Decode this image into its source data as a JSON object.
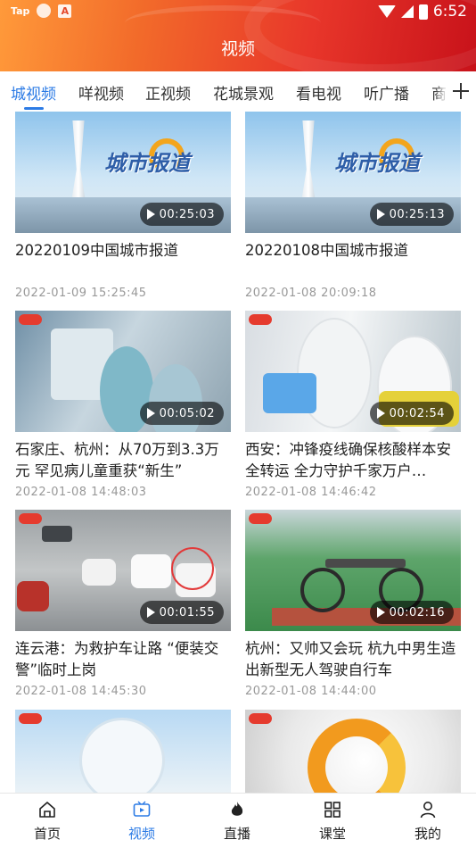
{
  "status_bar": {
    "left_label": "Tap",
    "left_letter": "A",
    "time": "6:52"
  },
  "header": {
    "title": "视频"
  },
  "tabs": [
    {
      "label": "城视频",
      "active": true
    },
    {
      "label": "咩视频",
      "active": false
    },
    {
      "label": "正视频",
      "active": false
    },
    {
      "label": "花城景观",
      "active": false
    },
    {
      "label": "看电视",
      "active": false
    },
    {
      "label": "听广播",
      "active": false
    },
    {
      "label": "商",
      "active": false
    }
  ],
  "thumbnail_captions": {
    "city_report": "城市报道",
    "city_report_prefix": "中国"
  },
  "videos": [
    {
      "title": "20220109中国城市报道",
      "duration": "00:25:03",
      "date": "2022-01-09  15:25:45"
    },
    {
      "title": "20220108中国城市报道",
      "duration": "00:25:13",
      "date": "2022-01-08  20:09:18"
    },
    {
      "title": "石家庄、杭州：从70万到3.3万元  罕见病儿童重获“新生”",
      "duration": "00:05:02",
      "date": "2022-01-08  14:48:03"
    },
    {
      "title": "西安：冲锋疫线确保核酸样本安全转运  全力守护千家万户…",
      "duration": "00:02:54",
      "date": "2022-01-08  14:46:42"
    },
    {
      "title": "连云港：为救护车让路 “便装交警”临时上岗",
      "duration": "00:01:55",
      "date": "2022-01-08  14:45:30"
    },
    {
      "title": "杭州：又帅又会玩  杭九中男生造出新型无人驾驶自行车",
      "duration": "00:02:16",
      "date": "2022-01-08  14:44:00"
    },
    {
      "title": "",
      "duration": "",
      "date": ""
    },
    {
      "title": "",
      "duration": "",
      "date": ""
    }
  ],
  "bottom_nav": [
    {
      "label": "首页",
      "icon": "home-icon",
      "active": false
    },
    {
      "label": "视频",
      "icon": "video-icon",
      "active": true
    },
    {
      "label": "直播",
      "icon": "live-flame-icon",
      "active": false
    },
    {
      "label": "课堂",
      "icon": "grid-icon",
      "active": false
    },
    {
      "label": "我的",
      "icon": "user-icon",
      "active": false
    }
  ],
  "colors": {
    "accent": "#2c7be5",
    "header_start": "#ff9a3a",
    "header_end": "#c8121a"
  }
}
